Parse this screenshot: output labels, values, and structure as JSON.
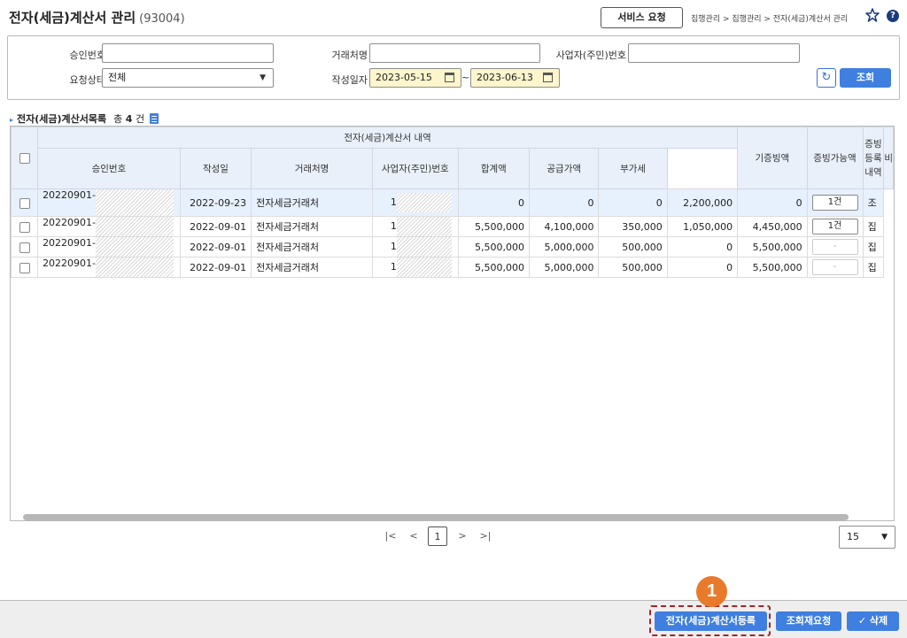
{
  "header": {
    "title": "전자(세금)계산서 관리",
    "screen_code": "(93004)",
    "service_request_label": "서비스 요청",
    "breadcrumb": "집행관리 > 집행관리 > 전자(세금)계산서 관리",
    "help_label": "?"
  },
  "search": {
    "approval_no_label": "승인번호",
    "approval_no_value": "",
    "vendor_name_label": "거래처명",
    "vendor_name_value": "",
    "biz_no_label": "사업자(주민)번호",
    "biz_no_value": "",
    "status_label": "요청상태",
    "status_value": "전체",
    "date_label": "작성일자",
    "date_from": "2023-05-15",
    "date_to": "2023-06-13",
    "date_sep": "~",
    "search_button": "조회"
  },
  "list": {
    "title": "전자(세금)계산서목록",
    "count_prefix": "총",
    "count": "4",
    "count_suffix": "건"
  },
  "table": {
    "group_header": "전자(세금)계산서 내역",
    "columns": {
      "approval_no": "승인번호",
      "date": "작성일",
      "vendor": "거래처명",
      "biz_no": "사업자(주민)번호",
      "total": "합계액",
      "supply": "공급가액",
      "vat": "부가세",
      "existing_evidence": "기증빙액",
      "available": "증빙가능액",
      "evidence_list": "증빙\n등록\n내역",
      "extra": "비"
    },
    "rows": [
      {
        "approval_no": "20220901-",
        "date": "2022-09-23",
        "vendor": "전자세금거래처",
        "biz_no": "1",
        "total": "0",
        "supply": "0",
        "vat": "0",
        "existing": "2,200,000",
        "available": "0",
        "evidence": "1건",
        "extra": "조"
      },
      {
        "approval_no": "20220901-",
        "date": "2022-09-01",
        "vendor": "전자세금거래처",
        "biz_no": "1",
        "total": "5,500,000",
        "supply": "4,100,000",
        "vat": "350,000",
        "existing": "1,050,000",
        "available": "4,450,000",
        "evidence": "1건",
        "extra": "집"
      },
      {
        "approval_no": "20220901-",
        "date": "2022-09-01",
        "vendor": "전자세금거래처",
        "biz_no": "1",
        "total": "5,500,000",
        "supply": "5,000,000",
        "vat": "500,000",
        "existing": "0",
        "available": "5,500,000",
        "evidence": "-",
        "extra": "집"
      },
      {
        "approval_no": "20220901-",
        "date": "2022-09-01",
        "vendor": "전자세금거래처",
        "biz_no": "1",
        "total": "5,500,000",
        "supply": "5,000,000",
        "vat": "500,000",
        "existing": "0",
        "available": "5,500,000",
        "evidence": "-",
        "extra": "집"
      }
    ]
  },
  "pagination": {
    "first": "|<",
    "prev": "<",
    "current": "1",
    "next": ">",
    "last": ">|",
    "page_size": "15"
  },
  "footer": {
    "register_button": "전자(세금)계산서등록",
    "re_query_button": "조회재요청",
    "delete_button": "✓ 삭제",
    "step_marker": "1"
  },
  "colors": {
    "primary": "#3f7fe0",
    "header_bg": "#e9f0fa",
    "date_bg": "#fdf5cc",
    "marker": "#ea7a2b",
    "highlight": "#a3262a"
  }
}
